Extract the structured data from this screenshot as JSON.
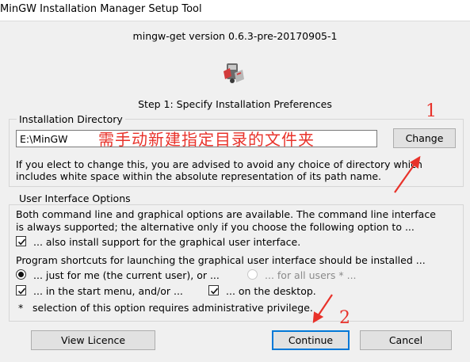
{
  "window": {
    "title": "MinGW Installation Manager Setup Tool"
  },
  "header": {
    "version": "mingw-get version 0.6.3-pre-20170905-1",
    "step": "Step 1: Specify Installation Preferences"
  },
  "install_dir": {
    "legend": "Installation Directory",
    "value": "E:\\MinGW",
    "change_label": "Change",
    "note_line1": "If you elect to change this, you are advised to avoid any choice of directory which",
    "note_line2": "includes white space within the absolute representation of its path name."
  },
  "ui_options": {
    "legend": "User Interface Options",
    "desc_line1": "Both command line and graphical options are available.  The command line interface",
    "desc_line2": "is always supported; the alternative only if you choose the following option to ...",
    "gui_support_label": "... also install support for the graphical user interface.",
    "shortcuts_line": "Program shortcuts for launching the graphical user interface should be installed ...",
    "just_me_label": "... just for me (the current user), or ...",
    "all_users_label": "... for all users * ...",
    "start_menu_label": "... in the start menu, and/or ...",
    "desktop_label": "... on the desktop.",
    "footnote_star": "*",
    "footnote": "selection of this option requires administrative privilege."
  },
  "buttons": {
    "view_licence": "View Licence",
    "continue": "Continue",
    "cancel": "Cancel"
  },
  "annotations": {
    "chinese_note": "需手动新建指定目录的文件夹",
    "marker1": "1",
    "marker2": "2",
    "color": "#e8322a"
  }
}
